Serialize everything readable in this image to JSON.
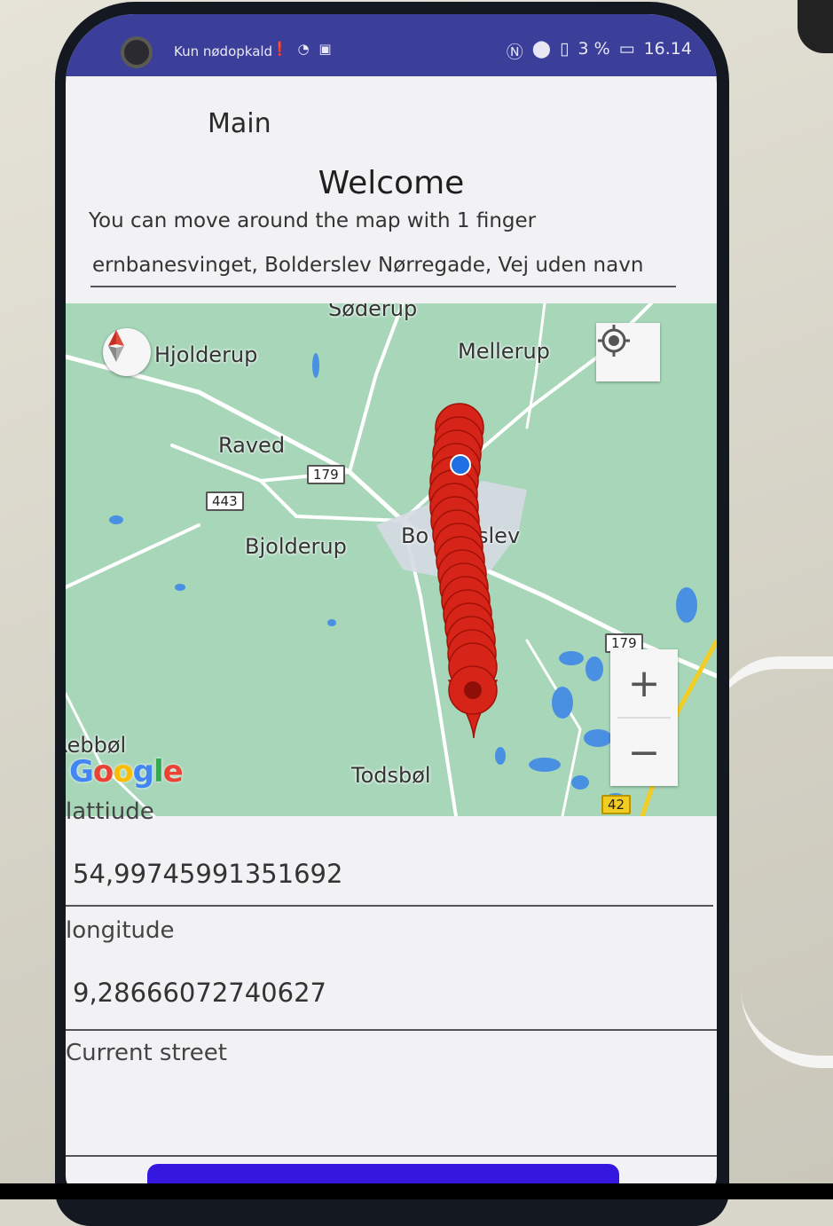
{
  "status_bar": {
    "carrier": "Kun nødopkald",
    "battery": "3 %",
    "time": "16.14"
  },
  "app": {
    "title": "Main",
    "welcome": "Welcome",
    "instruction": "You can move around the map with 1 finger",
    "address": "ernbanesvinget, Bolderslev Nørregade, Vej uden navn"
  },
  "map": {
    "places": [
      "Søderup",
      "Hjolderup",
      "Mellerup",
      "Raved",
      "Bjolderup",
      "Bo",
      "slev",
      "Rebbøl",
      "Todsbøl"
    ],
    "roads": [
      "179",
      "443",
      "179",
      "42"
    ],
    "zoom_in": "+",
    "zoom_out": "−",
    "logo": "Google",
    "colors": {
      "land": "#a7d6b9",
      "water": "#4a90e2",
      "route_marker": "#d62418",
      "location_dot": "#1f6fe5"
    }
  },
  "form": {
    "latitude_label": "lattiude",
    "latitude_value": "54,99745991351692",
    "longitude_label": "longitude",
    "longitude_value": "9,28666072740627",
    "street_label": "Current street",
    "street_value": ""
  }
}
